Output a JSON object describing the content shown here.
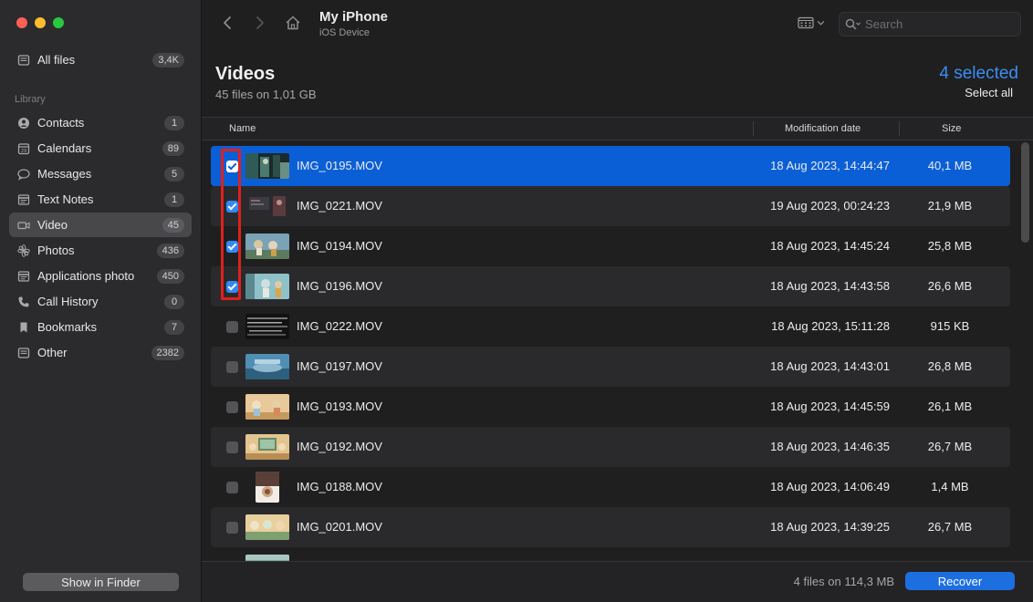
{
  "sidebar": {
    "all_files": {
      "label": "All files",
      "count": "3,4K"
    },
    "library_label": "Library",
    "items": [
      {
        "label": "Contacts",
        "count": "1",
        "icon": "contacts-icon"
      },
      {
        "label": "Calendars",
        "count": "89",
        "icon": "calendar-icon"
      },
      {
        "label": "Messages",
        "count": "5",
        "icon": "message-icon"
      },
      {
        "label": "Text Notes",
        "count": "1",
        "icon": "note-icon"
      },
      {
        "label": "Video",
        "count": "45",
        "icon": "video-icon"
      },
      {
        "label": "Photos",
        "count": "436",
        "icon": "photos-icon"
      },
      {
        "label": "Applications photo",
        "count": "450",
        "icon": "app-photo-icon"
      },
      {
        "label": "Call History",
        "count": "0",
        "icon": "phone-icon"
      },
      {
        "label": "Bookmarks",
        "count": "7",
        "icon": "bookmark-icon"
      },
      {
        "label": "Other",
        "count": "2382",
        "icon": "other-icon"
      }
    ],
    "show_in_finder": "Show in Finder"
  },
  "toolbar": {
    "title": "My iPhone",
    "subtitle": "iOS Device",
    "search_placeholder": "Search"
  },
  "content": {
    "heading": "Videos",
    "subheading": "45 files on 1,01 GB",
    "selected_count": "4 selected",
    "select_all": "Select all"
  },
  "table": {
    "columns": {
      "name": "Name",
      "date": "Modification date",
      "size": "Size"
    },
    "rows": [
      {
        "name": "IMG_0195.MOV",
        "date": "18 Aug 2023, 14:44:47",
        "size": "40,1 MB",
        "checked": true
      },
      {
        "name": "IMG_0221.MOV",
        "date": "19 Aug 2023, 00:24:23",
        "size": "21,9 MB",
        "checked": true
      },
      {
        "name": "IMG_0194.MOV",
        "date": "18 Aug 2023, 14:45:24",
        "size": "25,8 MB",
        "checked": true
      },
      {
        "name": "IMG_0196.MOV",
        "date": "18 Aug 2023, 14:43:58",
        "size": "26,6 MB",
        "checked": true
      },
      {
        "name": "IMG_0222.MOV",
        "date": "18 Aug 2023, 15:11:28",
        "size": "915 KB",
        "checked": false
      },
      {
        "name": "IMG_0197.MOV",
        "date": "18 Aug 2023, 14:43:01",
        "size": "26,8 MB",
        "checked": false
      },
      {
        "name": "IMG_0193.MOV",
        "date": "18 Aug 2023, 14:45:59",
        "size": "26,1 MB",
        "checked": false
      },
      {
        "name": "IMG_0192.MOV",
        "date": "18 Aug 2023, 14:46:35",
        "size": "26,7 MB",
        "checked": false
      },
      {
        "name": "IMG_0188.MOV",
        "date": "18 Aug 2023, 14:06:49",
        "size": "1,4 MB",
        "checked": false
      },
      {
        "name": "IMG_0201.MOV",
        "date": "18 Aug 2023, 14:39:25",
        "size": "26,7 MB",
        "checked": false
      }
    ]
  },
  "footer": {
    "info": "4 files on 114,3 MB",
    "recover": "Recover"
  },
  "colors": {
    "accent": "#3a8ef6",
    "selected_row": "#0b5fd6",
    "highlight": "#e0201c"
  }
}
